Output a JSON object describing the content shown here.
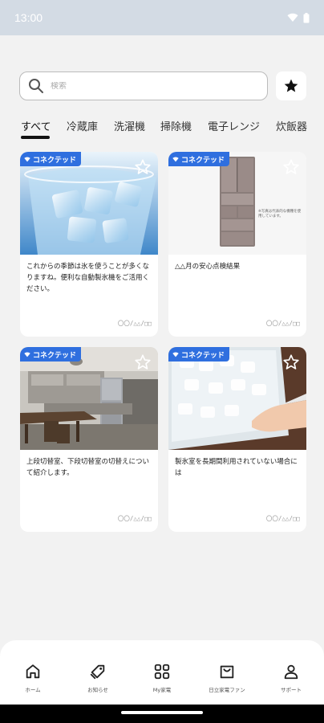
{
  "status_bar": {
    "time": "13:00"
  },
  "search": {
    "placeholder": "検索"
  },
  "tabs": [
    {
      "label": "すべて",
      "active": true
    },
    {
      "label": "冷蔵庫"
    },
    {
      "label": "洗濯機"
    },
    {
      "label": "掃除機"
    },
    {
      "label": "電子レンジ"
    },
    {
      "label": "炊飯器"
    }
  ],
  "cards": [
    {
      "badge": "コネクテッド",
      "image_caption": "",
      "text": "これからの季節は氷を使うことが多くなりますね。便利な自動製氷機をご活用ください。",
      "date": "〇〇/△△/□□"
    },
    {
      "badge": "コネクテッド",
      "image_caption": "※写真は代表的な機種を使用しています。",
      "text": "△△月の安心点検結果",
      "date": "〇〇/△△/□□"
    },
    {
      "badge": "コネクテッド",
      "image_caption": "",
      "text": "上段切替室、下段切替室の切替えについて紹介します。",
      "date": "〇〇/△△/□□"
    },
    {
      "badge": "コネクテッド",
      "image_caption": "",
      "text": "製氷室を長期間利用されていない場合には",
      "date": "〇〇/△△/□□"
    }
  ],
  "bottom_nav": [
    {
      "label": "ホーム",
      "icon": "home-icon"
    },
    {
      "label": "お知らせ",
      "icon": "tag-icon"
    },
    {
      "label": "My家電",
      "icon": "grid-icon"
    },
    {
      "label": "日立家電ファン",
      "icon": "bag-icon"
    },
    {
      "label": "サポート",
      "icon": "person-icon"
    }
  ],
  "colors": {
    "accent": "#2f6fdf",
    "background": "#f2f2f2",
    "status_bar": "#d3dbe4"
  }
}
